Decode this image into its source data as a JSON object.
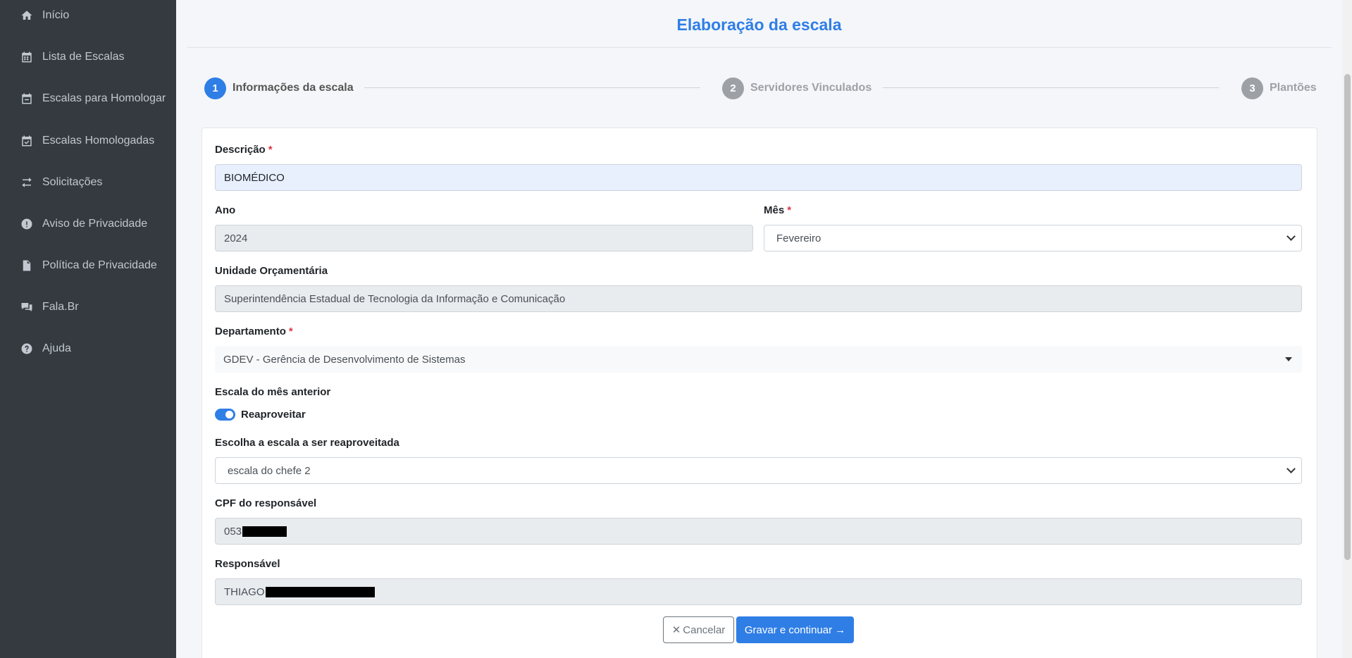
{
  "sidebar": {
    "items": [
      {
        "label": "Início",
        "icon": "home-icon"
      },
      {
        "label": "Lista de Escalas",
        "icon": "calendar-grid-icon"
      },
      {
        "label": "Escalas para Homologar",
        "icon": "calendar-minus-icon"
      },
      {
        "label": "Escalas Homologadas",
        "icon": "calendar-check-icon"
      },
      {
        "label": "Solicitações",
        "icon": "exchange-arrows-icon"
      },
      {
        "label": "Aviso de Privacidade",
        "icon": "exclamation-circle-icon"
      },
      {
        "label": "Política de Privacidade",
        "icon": "file-icon"
      },
      {
        "label": "Fala.Br",
        "icon": "comments-icon"
      },
      {
        "label": "Ajuda",
        "icon": "question-circle-icon"
      }
    ]
  },
  "page": {
    "title": "Elaboração da escala"
  },
  "steps": [
    {
      "number": "1",
      "label": "Informações da escala",
      "active": true
    },
    {
      "number": "2",
      "label": "Servidores Vinculados",
      "active": false
    },
    {
      "number": "3",
      "label": "Plantões",
      "active": false
    }
  ],
  "form": {
    "descricao": {
      "label": "Descrição",
      "required_mark": "*",
      "value": "BIOMÉDICO"
    },
    "ano": {
      "label": "Ano",
      "value": "2024"
    },
    "mes": {
      "label": "Mês",
      "required_mark": "*",
      "value": "Fevereiro"
    },
    "unidade": {
      "label": "Unidade Orçamentária",
      "value": "Superintendência Estadual de Tecnologia da Informação e Comunicação"
    },
    "departamento": {
      "label": "Departamento",
      "required_mark": "*",
      "value": "GDEV - Gerência de Desenvolvimento de Sistemas"
    },
    "escala_anterior": {
      "label": "Escala do mês anterior",
      "toggle_label": "Reaproveitar",
      "toggle_on": true
    },
    "escala_reaproveitada": {
      "label": "Escolha a escala a ser reaproveitada",
      "value": "escala do chefe 2"
    },
    "cpf": {
      "label": "CPF do responsável",
      "value": "053"
    },
    "responsavel": {
      "label": "Responsável",
      "value": "THIAGO"
    }
  },
  "buttons": {
    "cancel_label": "Cancelar",
    "save_label": "Gravar e continuar"
  },
  "colors": {
    "primary": "#2f7ee6",
    "sidebar": "#343a40",
    "required": "#dc3545"
  }
}
